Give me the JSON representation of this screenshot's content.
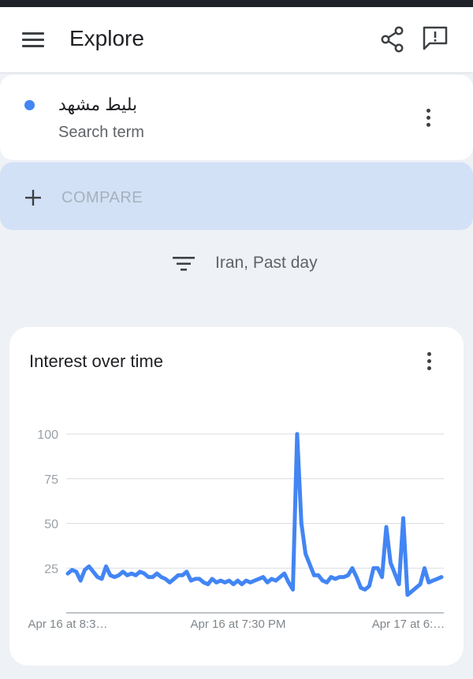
{
  "app": {
    "title": "Explore"
  },
  "header": {
    "menu_icon": "menu-icon",
    "share_icon": "share-icon",
    "feedback_icon": "feedback-icon"
  },
  "search_term": {
    "name": "بليط مشهد",
    "type_label": "Search term",
    "color": "#4285f4"
  },
  "compare": {
    "label": "COMPARE"
  },
  "filter": {
    "label": "Iran, Past day"
  },
  "interest_card": {
    "title": "Interest over time"
  },
  "colors": {
    "accent": "#4285f4",
    "compare_bg": "#d2e1f6",
    "background": "#eef1f6"
  },
  "chart_data": {
    "type": "line",
    "title": "Interest over time",
    "ylim": [
      0,
      100
    ],
    "y_ticks": [
      100,
      75,
      50,
      25
    ],
    "x_tick_labels": [
      "Apr 16 at 8:3…",
      "Apr 16 at 7:30 PM",
      "Apr 17 at 6:…"
    ],
    "grid": true,
    "series": [
      {
        "color": "#4285f4",
        "values": [
          22,
          24,
          23,
          18,
          24,
          26,
          23,
          20,
          19,
          26,
          21,
          20,
          21,
          23,
          21,
          22,
          21,
          23,
          22,
          20,
          20,
          22,
          20,
          19,
          17,
          19,
          21,
          21,
          23,
          18,
          19,
          19,
          17,
          16,
          19,
          17,
          18,
          17,
          18,
          16,
          18,
          16,
          18,
          17,
          18,
          19,
          20,
          17,
          19,
          18,
          20,
          22,
          17,
          13,
          100,
          50,
          33,
          27,
          21,
          21,
          18,
          17,
          20,
          19,
          20,
          20,
          21,
          25,
          20,
          14,
          13,
          15,
          25,
          25,
          20,
          48,
          28,
          22,
          16,
          53,
          10,
          12,
          14,
          16,
          25,
          17,
          18,
          19,
          20
        ]
      }
    ]
  }
}
